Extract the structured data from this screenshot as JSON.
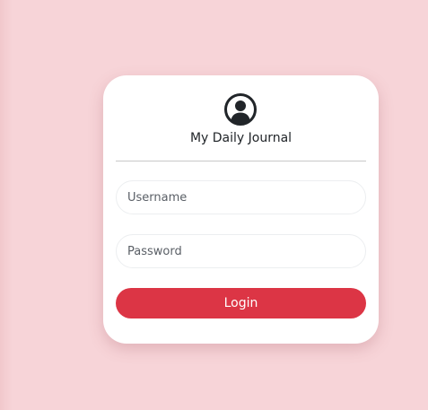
{
  "app": {
    "title": "My Daily Journal",
    "icon": "user-avatar-icon"
  },
  "form": {
    "username": {
      "placeholder": "Username",
      "value": ""
    },
    "password": {
      "placeholder": "Password",
      "value": ""
    },
    "login_label": "Login"
  },
  "colors": {
    "background": "#f7d4d8",
    "card": "#ffffff",
    "accent": "#dc3545",
    "text": "#212529"
  }
}
